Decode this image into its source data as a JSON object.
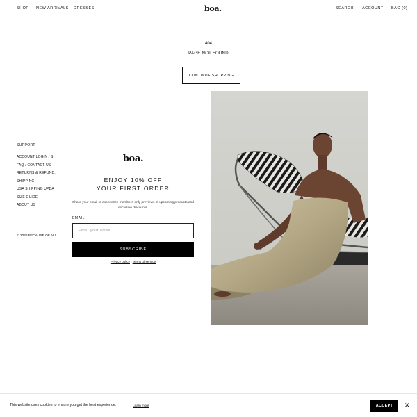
{
  "header": {
    "nav_left": [
      "SHOP",
      "NEW ARRIVALS",
      "DRESSES"
    ],
    "logo": "boa.",
    "nav_right": {
      "search": "SEARCH",
      "account": "ACCOUNT",
      "bag": "BAG (0)"
    }
  },
  "main": {
    "code": "404",
    "message": "PAGE NOT FOUND",
    "continue_label": "CONTINUE SHOPPING"
  },
  "footer": {
    "title": "SUPPORT",
    "links": [
      "ACCOUNT LOGIN / S",
      "FAQ / CONTACT US",
      "RETURNS & REFUND:",
      "SHIPPING",
      "USA SHIPPING UPDA",
      "SIZE GUIDE",
      "ABOUT US"
    ],
    "copyright": "© 2026 BECAUSE OF ALIC"
  },
  "modal": {
    "logo": "boa.",
    "headline_1": "ENJOY 10% OFF",
    "headline_2": "YOUR FIRST ORDER",
    "description": "Share your email to experience members-only previews of upcoming products and exclusive discounts.",
    "email_label": "EMAIL",
    "email_placeholder": "Enter your email",
    "subscribe_label": "SUBSCRIBE",
    "privacy_label": "Privacy policy",
    "separator": " | ",
    "terms_label": "Terms of service",
    "close_glyph": "×"
  },
  "cookie": {
    "text": "This website uses cookies to ensure you get the best experience.",
    "learn_more": "Learn more",
    "accept_label": "ACCEPT",
    "close_glyph": "✕"
  },
  "colors": {
    "accent": "#000000",
    "border": "#e6e6e6",
    "photo_backdrop": "#d8d8d3",
    "dress": "#b9ad8d",
    "skin": "#6b4432"
  }
}
